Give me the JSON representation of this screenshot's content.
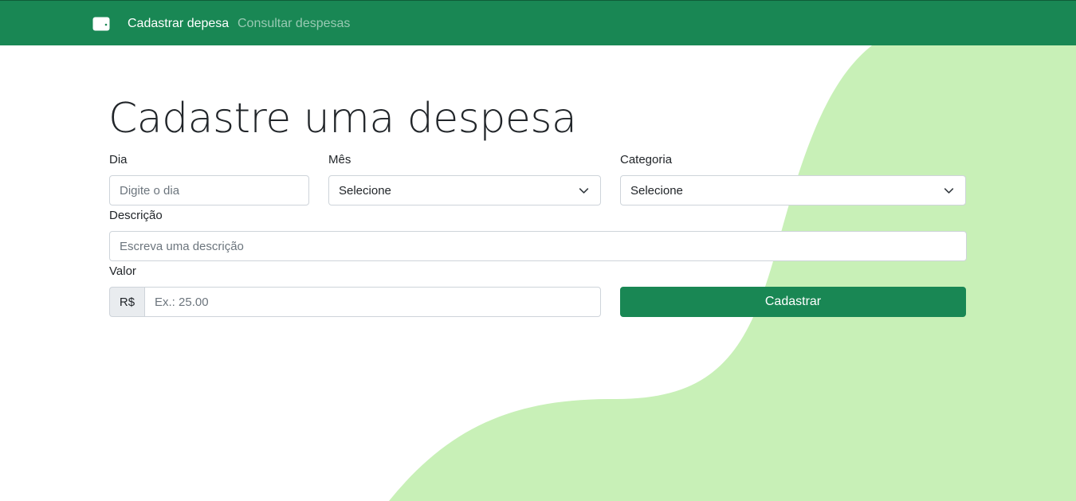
{
  "colors": {
    "navbar": "#198754",
    "accent_blob": "#c8f0b7",
    "button": "#198754"
  },
  "navbar": {
    "brand_icon": "wallet-icon",
    "links": [
      {
        "label": "Cadastrar depesa",
        "active": true
      },
      {
        "label": "Consultar despesas",
        "active": false
      }
    ]
  },
  "page": {
    "title": "Cadastre uma despesa"
  },
  "form": {
    "dia": {
      "label": "Dia",
      "placeholder": "Digite o dia",
      "value": ""
    },
    "mes": {
      "label": "Mês",
      "selected": "Selecione"
    },
    "categoria": {
      "label": "Categoria",
      "selected": "Selecione"
    },
    "descricao": {
      "label": "Descrição",
      "placeholder": "Escreva uma descrição",
      "value": ""
    },
    "valor": {
      "label": "Valor",
      "prefix": "R$",
      "placeholder": "Ex.: 25.00",
      "value": ""
    },
    "submit_label": "Cadastrar"
  }
}
